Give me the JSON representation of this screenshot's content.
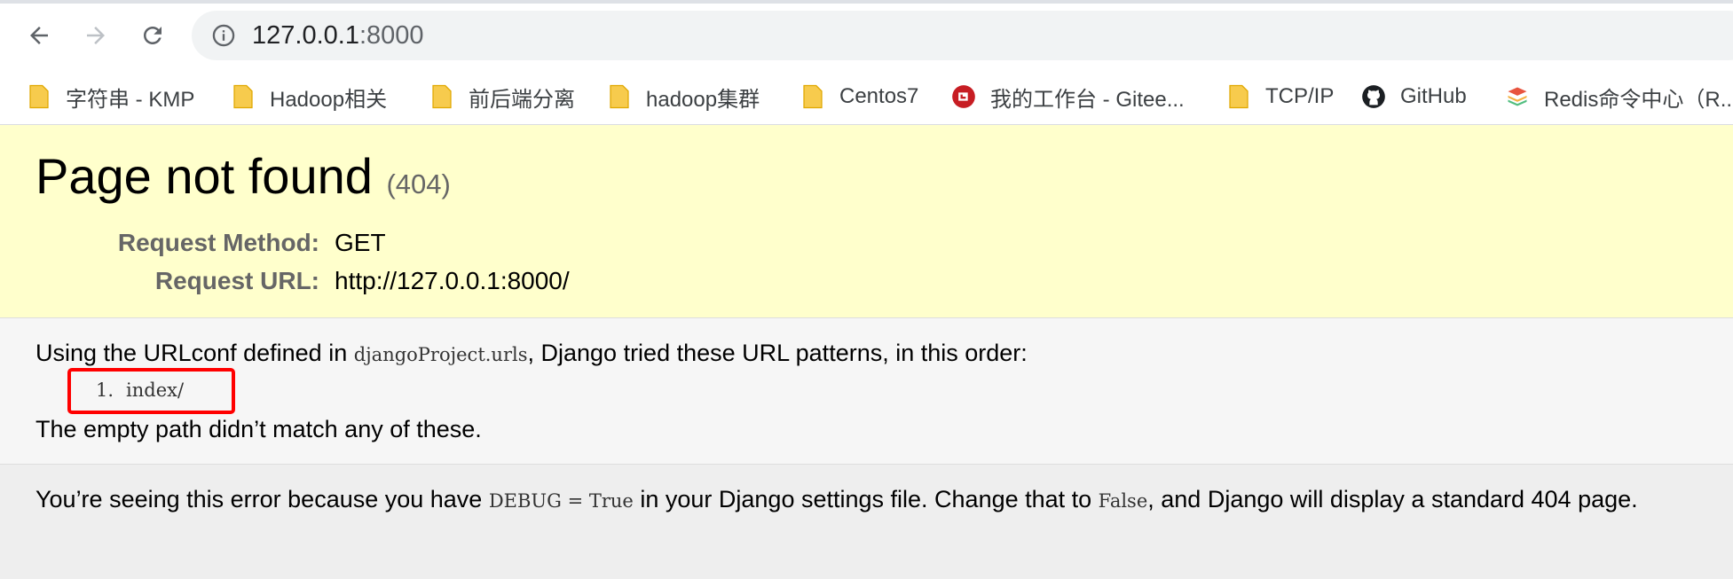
{
  "browser": {
    "url_host": "127.0.0.1",
    "url_port": ":8000",
    "icons": [
      "back-arrow-icon",
      "forward-arrow-icon",
      "reload-icon",
      "info-icon"
    ]
  },
  "bookmarks": [
    {
      "label": "字符串 - KMP",
      "icon": "folder-icon"
    },
    {
      "label": "Hadoop相关",
      "icon": "folder-icon"
    },
    {
      "label": "前后端分离",
      "icon": "folder-icon"
    },
    {
      "label": "hadoop集群",
      "icon": "folder-icon"
    },
    {
      "label": "Centos7",
      "icon": "folder-icon"
    },
    {
      "label": "我的工作台 - Gitee...",
      "icon": "gitee-icon"
    },
    {
      "label": "TCP/IP",
      "icon": "folder-icon"
    },
    {
      "label": "GitHub",
      "icon": "github-icon"
    },
    {
      "label": "Redis命令中心（R...",
      "icon": "redis-icon"
    }
  ],
  "page": {
    "title": "Page not found",
    "status_code": "(404)",
    "request_method_label": "Request Method:",
    "request_method": "GET",
    "request_url_label": "Request URL:",
    "request_url": "http://127.0.0.1:8000/",
    "urlconf_prefix": "Using the URLconf defined in ",
    "urlconf_module": "djangoProject.urls",
    "urlconf_suffix": ", Django tried these URL patterns, in this order:",
    "patterns": [
      {
        "num": "1.",
        "pattern": "index/"
      }
    ],
    "no_match": "The empty path didn’t match any of these.",
    "explanation_1": "You’re seeing this error because you have ",
    "debug_setting": "DEBUG = True",
    "explanation_2": " in your Django settings file. Change that to ",
    "false_value": "False",
    "explanation_3": ", and Django will display a standard 404 page."
  },
  "colors": {
    "summary_bg": "#ffffcc",
    "info_bg": "#f6f6f6",
    "explanation_bg": "#eeeeee",
    "highlight_border": "#ff0000",
    "folder": "#f7cb4d",
    "gitee": "#c71d23"
  }
}
